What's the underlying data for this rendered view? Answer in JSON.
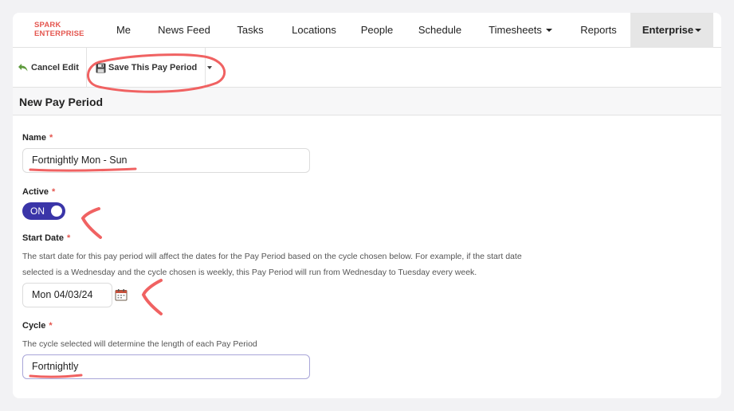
{
  "brand": {
    "line1": "SPARK",
    "line2": "ENTERPRISE"
  },
  "nav": {
    "items": [
      {
        "label": "Me"
      },
      {
        "label": "News Feed"
      },
      {
        "label": "Tasks"
      },
      {
        "label": "Locations"
      },
      {
        "label": "People"
      },
      {
        "label": "Schedule"
      },
      {
        "label": "Timesheets"
      },
      {
        "label": "Reports"
      },
      {
        "label": "Enterprise"
      }
    ],
    "active": "Enterprise"
  },
  "toolbar": {
    "cancel_label": "Cancel Edit",
    "save_label": "Save This Pay Period"
  },
  "section": {
    "title": "New Pay Period"
  },
  "form": {
    "name": {
      "label": "Name",
      "value": "Fortnightly Mon - Sun"
    },
    "active": {
      "label": "Active",
      "state": "ON"
    },
    "start_date": {
      "label": "Start Date",
      "help_line1": "The start date for this pay period will affect the dates for the Pay Period based on the cycle chosen below. For example, if the start date",
      "help_line2": "selected is a Wednesday and the cycle chosen is weekly, this Pay Period will run from Wednesday to Tuesday every week.",
      "value": "Mon 04/03/24"
    },
    "cycle": {
      "label": "Cycle",
      "help": "The cycle selected will determine the length of each Pay Period",
      "value": "Fortnightly"
    },
    "required_marker": "*"
  },
  "colors": {
    "brand": "#e4564f",
    "toggle_on": "#3a35a8",
    "annotation": "#f06262"
  },
  "icons": {
    "cancel": "undo-arrow-icon",
    "save": "floppy-disk-icon",
    "calendar": "calendar-icon"
  }
}
